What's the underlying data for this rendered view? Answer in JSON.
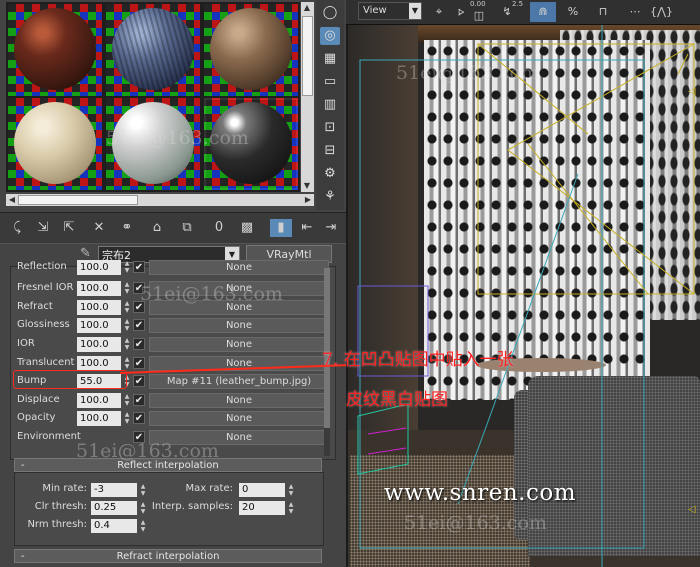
{
  "material_editor": {
    "slot_tools": [
      "sphere-icon",
      "sample-type-icon",
      "background-checker-icon",
      "backlight-icon",
      "uv-tiling-icon",
      "video-check-icon",
      "make-preview-icon",
      "options-icon",
      "select-by-material-icon"
    ],
    "toolbar_icons": [
      "get-material-icon",
      "put-to-scene-icon",
      "assign-to-selection-icon",
      "delete-icon",
      "make-unique-icon",
      "put-to-library-icon",
      "material-id-icon",
      "show-map-icon",
      "show-end-result-icon",
      "go-to-parent-icon",
      "go-forward-icon"
    ],
    "material_id_value": "0",
    "material_name": "宗布2",
    "material_type": "VRayMtl",
    "params": [
      {
        "label": "Reflection",
        "value": "100.0",
        "map": "None"
      },
      {
        "label": "Fresnel IOR",
        "value": "100.0",
        "map": "None"
      },
      {
        "label": "Refract",
        "value": "100.0",
        "map": "None"
      },
      {
        "label": "Glossiness",
        "value": "100.0",
        "map": "None"
      },
      {
        "label": "IOR",
        "value": "100.0",
        "map": "None"
      },
      {
        "label": "Translucent",
        "value": "100.0",
        "map": "None"
      },
      {
        "label": "Bump",
        "value": "55.0",
        "map": "Map #11 (leather_bump.jpg)"
      },
      {
        "label": "Displace",
        "value": "100.0",
        "map": "None"
      },
      {
        "label": "Opacity",
        "value": "100.0",
        "map": "None"
      },
      {
        "label": "Environment",
        "value": "",
        "map": "None"
      }
    ],
    "reflect_interp": {
      "title": "Reflect interpolation",
      "min_rate_label": "Min rate:",
      "min_rate": "-3",
      "max_rate_label": "Max rate:",
      "max_rate": "0",
      "clr_thresh_label": "Clr thresh:",
      "clr_thresh": "0.25",
      "interp_samples_label": "Interp. samples:",
      "interp_samples": "20",
      "nrm_thresh_label": "Nrm thresh:",
      "nrm_thresh": "0.4"
    },
    "refract_interp": {
      "title": "Refract interpolation"
    },
    "rollout_toggle": "-"
  },
  "viewport": {
    "view_label": "View",
    "spinner_a": "0.00",
    "spinner_b": "2.5",
    "toolbar_icons": [
      "select-object-icon",
      "angle-snap-icon",
      "percent-snap-icon",
      "spinner-snap-icon",
      "magnet-icon",
      "mirror-icon",
      "align-icon",
      "named-selection-icon"
    ]
  },
  "annotation": {
    "line1": "7. 在凹凸贴图中贴入一张",
    "line2": "皮纹黑白贴图",
    "url": "www.snren.com",
    "color": "#ff2020"
  },
  "watermarks": [
    "51ei@163.com",
    "51ei@163.com",
    "51ei@163.com",
    "51ei@163.com",
    "51ei@163.com"
  ]
}
